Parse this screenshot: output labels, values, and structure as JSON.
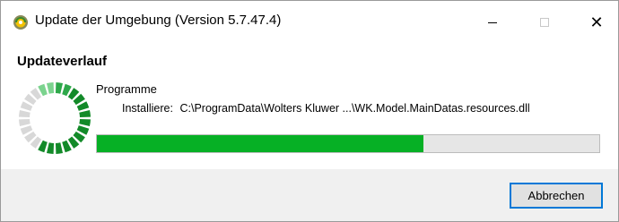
{
  "window": {
    "title": "Update der Umgebung (Version 5.7.47.4)",
    "app_icon": "update-app-icon",
    "controls": {
      "minimize": "minimize-icon",
      "maximize": "maximize-icon",
      "close_symbol": "✕"
    }
  },
  "main": {
    "heading": "Updateverlauf",
    "section_label": "Programme",
    "status_prefix": "Installiere:",
    "status_path": "C:\\ProgramData\\Wolters  Kluwer ...\\WK.Model.MainDatas.resources.dll",
    "progress_fraction": 0.65
  },
  "spinner": {
    "icon": "loading-spinner-icon",
    "segments_active_fraction": 0.68,
    "colors": {
      "dark": "#138a29",
      "mid": "#2ea84a",
      "light": "#7bd38e",
      "inactive": "#d8d8d8"
    }
  },
  "footer": {
    "cancel_label": "Abbrechen"
  },
  "colors": {
    "progress_fill": "#06b025",
    "progress_track": "#e6e6e6",
    "button_focus_border": "#0078d7"
  }
}
